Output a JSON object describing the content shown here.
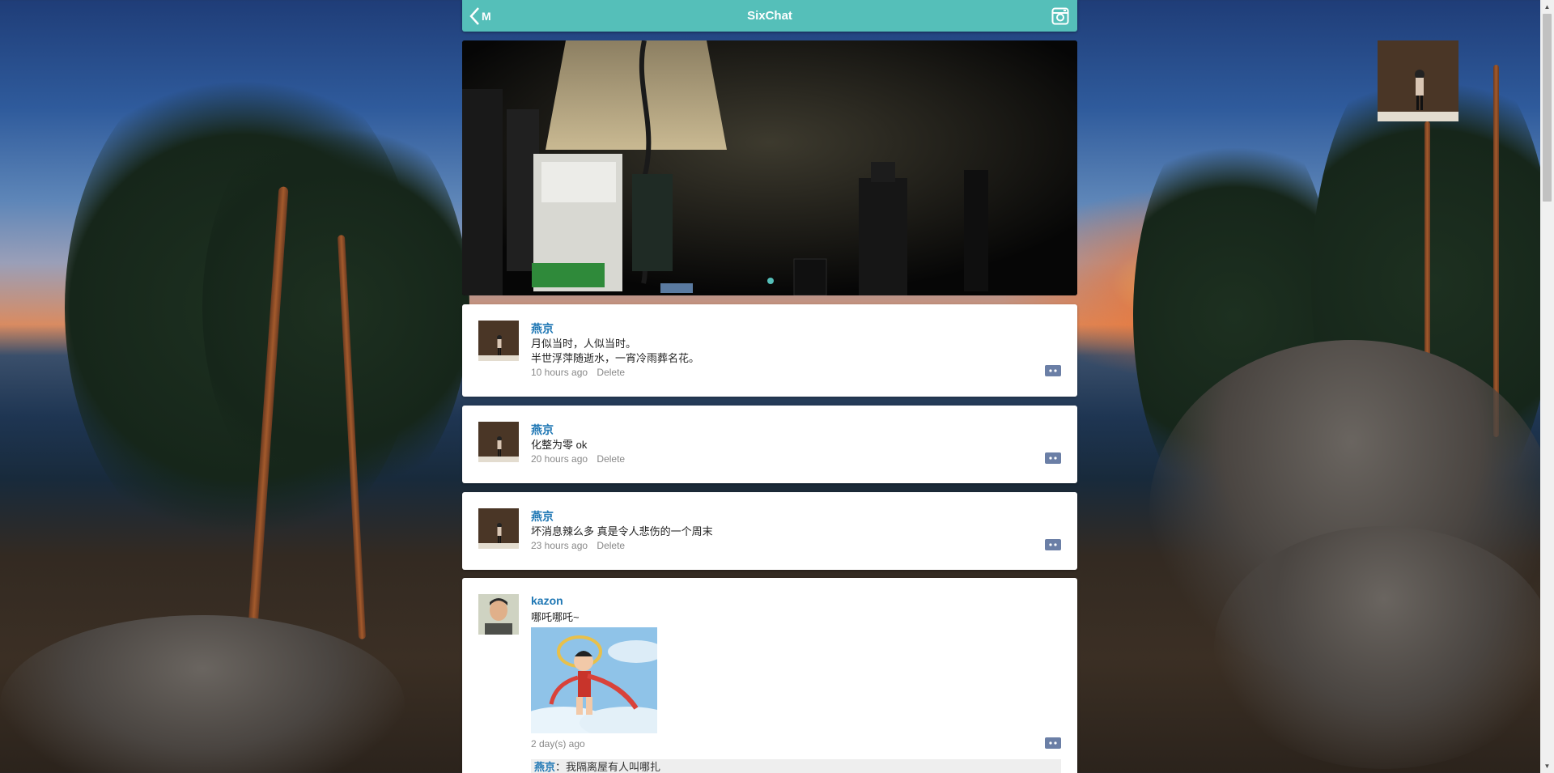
{
  "app": {
    "title": "SixChat",
    "back_label": "M"
  },
  "colors": {
    "accent": "#55bfb9",
    "author": "#1f77b4",
    "meta": "#888888"
  },
  "icons": {
    "back": "chevron-left-icon",
    "camera": "camera-icon",
    "comment": "comment-icon"
  },
  "banner": {
    "slide_count": 1,
    "active_slide": 1
  },
  "posts": [
    {
      "author": "燕京",
      "lines": [
        "月似当时，人似当时。",
        "半世浮萍随逝水，一宵冷雨葬名花。"
      ],
      "time": "10 hours ago",
      "delete_label": "Delete"
    },
    {
      "author": "燕京",
      "lines": [
        "化整为零 ok"
      ],
      "time": "20 hours ago",
      "delete_label": "Delete"
    },
    {
      "author": "燕京",
      "lines": [
        "坏消息辣么多 真是令人悲伤的一个周末"
      ],
      "time": "23 hours ago",
      "delete_label": "Delete"
    },
    {
      "author": "kazon",
      "lines": [
        "哪吒哪吒~"
      ],
      "time": "2 day(s) ago",
      "replies": [
        {
          "author": "燕京",
          "separator": "：",
          "text": "我隔离屋有人叫哪扎"
        }
      ]
    }
  ]
}
